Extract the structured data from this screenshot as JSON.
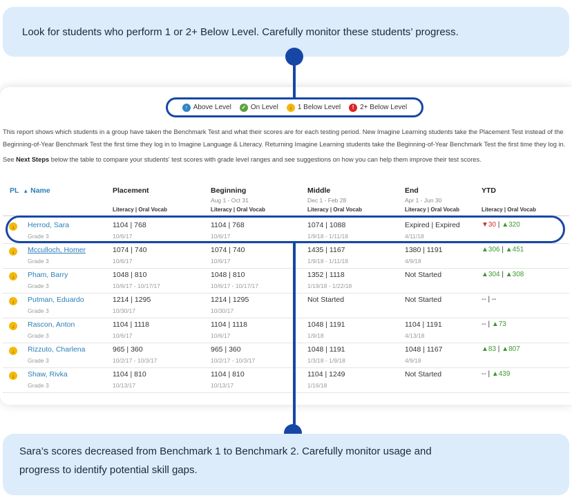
{
  "callouts": {
    "top": "Look for students who perform 1 or 2+ Below Level. Carefully monitor these students’ progress.",
    "bottom_line1": "Sara’s scores decreased from Benchmark 1 to Benchmark 2. Carefully monitor usage and",
    "bottom_line2": "progress to identify potential skill gaps."
  },
  "legend": [
    {
      "label": "Above Level",
      "icon": "arrow-up-icon",
      "color": "#2e86c8"
    },
    {
      "label": "On Level",
      "icon": "check-icon",
      "color": "#5ba33b"
    },
    {
      "label": "1 Below Level",
      "icon": "arrow-down-icon",
      "color": "#f3b90c"
    },
    {
      "label": "2+ Below Level",
      "icon": "exclamation-icon",
      "color": "#dc2626"
    }
  ],
  "report": {
    "description_line1": "This report shows which students in a group have taken the Benchmark Test and what their scores are for each testing period. New Imagine Learning students take the Placement Test instead of the",
    "description_line2": "Beginning-of-Year Benchmark Test the first time they log in to Imagine Language & Literacy. Returning Imagine Learning students take the Beginning-of-Year Benchmark Test the first time they log in.",
    "next_prefix": "See ",
    "next_bold": "Next Steps",
    "next_suffix": " below the table to compare your students' test scores with grade level ranges and see suggestions on how you can help them improve their test scores."
  },
  "table": {
    "headers": {
      "pl": "PL",
      "sort": "▲",
      "name": "Name",
      "placement": "Placement",
      "beginning": "Beginning",
      "middle": "Middle",
      "end": "End",
      "ytd": "YTD"
    },
    "dates": {
      "beginning": "Aug 1 - Oct 31",
      "middle": "Dec 1 - Feb 28",
      "end": "Apr 1 - Jun 30"
    },
    "subheader": "Literacy | Oral Vocab",
    "rows": [
      {
        "name": "Herrod, Sara",
        "grade": "Grade 3",
        "placement": "1104 | 768",
        "placement_date": "10/6/17",
        "beginning": "1104 | 768",
        "beginning_date": "10/6/17",
        "middle": "1074 | 1088",
        "middle_date": "1/9/18 - 1/11/18",
        "end": "Expired | Expired",
        "end_date": "4/11/18",
        "ytd_a_arrow": "▼",
        "ytd_a_dir": "down",
        "ytd_a": "30",
        "ytd_sep": " | ",
        "ytd_b_arrow": "▲",
        "ytd_b_dir": "up",
        "ytd_b": "320"
      },
      {
        "name": "Mcculloch, Homer",
        "grade": "Grade 3",
        "placement": "1074 | 740",
        "placement_date": "10/6/17",
        "beginning": "1074 | 740",
        "beginning_date": "10/6/17",
        "middle": "1435 | 1167",
        "middle_date": "1/9/18 - 1/11/18",
        "end": "1380 | 1191",
        "end_date": "4/9/18",
        "ytd_a_arrow": "▲",
        "ytd_a_dir": "up",
        "ytd_a": "306",
        "ytd_sep": " | ",
        "ytd_b_arrow": "▲",
        "ytd_b_dir": "up",
        "ytd_b": "451"
      },
      {
        "name": "Pham, Barry",
        "grade": "Grade 3",
        "placement": "1048 | 810",
        "placement_date": "10/6/17 - 10/17/17",
        "beginning": "1048 | 810",
        "beginning_date": "10/6/17 - 10/17/17",
        "middle": "1352 | 1118",
        "middle_date": "1/19/18 - 1/22/18",
        "end": "Not Started",
        "end_date": "",
        "ytd_a_arrow": "▲",
        "ytd_a_dir": "up",
        "ytd_a": "304",
        "ytd_sep": " | ",
        "ytd_b_arrow": "▲",
        "ytd_b_dir": "up",
        "ytd_b": "308"
      },
      {
        "name": "Putman, Eduardo",
        "grade": "Grade 3",
        "placement": "1214 | 1295",
        "placement_date": "10/30/17",
        "beginning": "1214 | 1295",
        "beginning_date": "10/30/17",
        "middle": "Not Started",
        "middle_date": "",
        "end": "Not Started",
        "end_date": "",
        "ytd_a_arrow": "",
        "ytd_a_dir": "",
        "ytd_a": "--",
        "ytd_sep": " | ",
        "ytd_b_arrow": "",
        "ytd_b_dir": "",
        "ytd_b": "--"
      },
      {
        "name": "Rascon, Anton",
        "grade": "Grade 3",
        "placement": "1104 | 1118",
        "placement_date": "10/6/17",
        "beginning": "1104 | 1118",
        "beginning_date": "10/6/17",
        "middle": "1048 | 1191",
        "middle_date": "1/9/18",
        "end": "1104 | 1191",
        "end_date": "4/13/18",
        "ytd_a_arrow": "",
        "ytd_a_dir": "",
        "ytd_a": "--",
        "ytd_sep": " | ",
        "ytd_b_arrow": "▲",
        "ytd_b_dir": "up",
        "ytd_b": "73"
      },
      {
        "name": "Rizzuto, Charlena",
        "grade": "Grade 3",
        "placement": "965 | 360",
        "placement_date": "10/2/17 - 10/3/17",
        "beginning": "965 | 360",
        "beginning_date": "10/2/17 - 10/3/17",
        "middle": "1048 | 1191",
        "middle_date": "1/3/18 - 1/9/18",
        "end": "1048 | 1167",
        "end_date": "4/9/18",
        "ytd_a_arrow": "▲",
        "ytd_a_dir": "up",
        "ytd_a": "83",
        "ytd_sep": " | ",
        "ytd_b_arrow": "▲",
        "ytd_b_dir": "up",
        "ytd_b": "807"
      },
      {
        "name": "Shaw, Rivka",
        "grade": "Grade 3",
        "placement": "1104 | 810",
        "placement_date": "10/13/17",
        "beginning": "1104 | 810",
        "beginning_date": "10/13/17",
        "middle": "1104 | 1249",
        "middle_date": "1/16/18",
        "end": "Not Started",
        "end_date": "",
        "ytd_a_arrow": "",
        "ytd_a_dir": "",
        "ytd_a": "--",
        "ytd_sep": " | ",
        "ytd_b_arrow": "▲",
        "ytd_b_dir": "up",
        "ytd_b": "439"
      }
    ]
  }
}
